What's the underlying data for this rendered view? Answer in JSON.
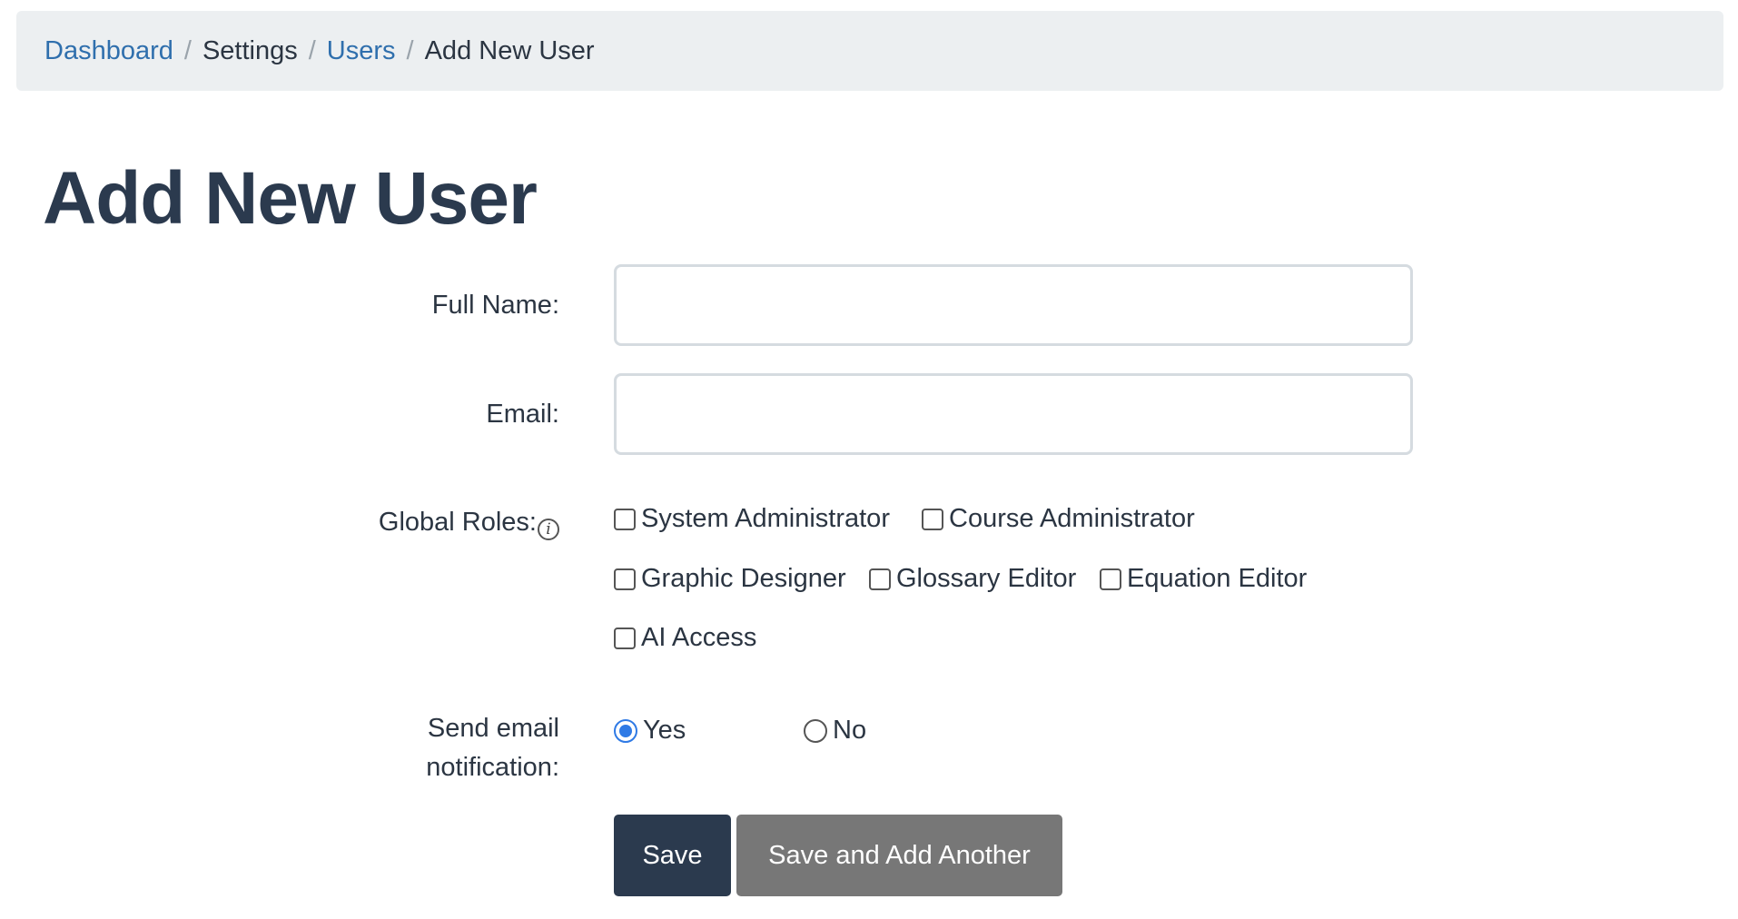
{
  "breadcrumb": {
    "items": [
      {
        "label": "Dashboard",
        "link": true
      },
      {
        "label": "Settings",
        "link": false
      },
      {
        "label": "Users",
        "link": true
      },
      {
        "label": "Add New User",
        "link": false
      }
    ],
    "separator": "/"
  },
  "page": {
    "title": "Add New User"
  },
  "form": {
    "full_name": {
      "label": "Full Name:",
      "value": "",
      "placeholder": ""
    },
    "email": {
      "label": "Email:",
      "value": "",
      "placeholder": ""
    },
    "global_roles": {
      "label": "Global Roles:",
      "info_icon": "i",
      "options": [
        {
          "label": "System Administrator",
          "checked": false
        },
        {
          "label": "Course Administrator",
          "checked": false
        },
        {
          "label": "Graphic Designer",
          "checked": false
        },
        {
          "label": "Glossary Editor",
          "checked": false
        },
        {
          "label": "Equation Editor",
          "checked": false
        },
        {
          "label": "AI Access",
          "checked": false
        }
      ]
    },
    "send_email": {
      "label_line1": "Send email",
      "label_line2": "notification:",
      "options": [
        {
          "label": "Yes",
          "checked": true
        },
        {
          "label": "No",
          "checked": false
        }
      ]
    },
    "buttons": {
      "save": "Save",
      "save_and_add": "Save and Add Another"
    }
  },
  "colors": {
    "link": "#2f6fad",
    "title": "#2b3a4e",
    "primary_button": "#2b3a4e",
    "secondary_button": "#777777",
    "radio_accent": "#2f7ae5",
    "breadcrumb_bg": "#eceff1"
  }
}
